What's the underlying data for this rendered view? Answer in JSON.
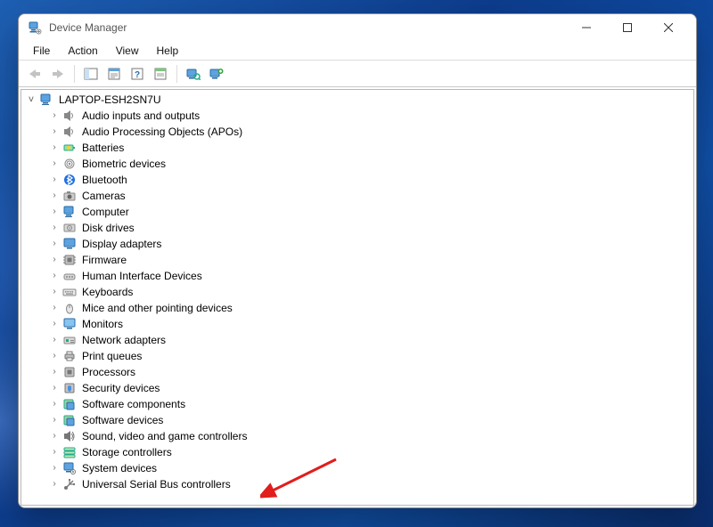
{
  "window": {
    "title": "Device Manager"
  },
  "menubar": {
    "file": "File",
    "action": "Action",
    "view": "View",
    "help": "Help"
  },
  "toolbar": {
    "back_tip": "Back",
    "forward_tip": "Forward",
    "show_hide_tip": "Show/Hide Console Tree",
    "properties_tip": "Properties",
    "help_tip": "Help",
    "scan_tip": "Scan for hardware changes",
    "add_driver_tip": "Add drivers"
  },
  "tree": {
    "root": {
      "label": "LAPTOP-ESH2SN7U",
      "icon": "computer",
      "expanded": true
    },
    "categories": [
      {
        "label": "Audio inputs and outputs",
        "icon": "audio"
      },
      {
        "label": "Audio Processing Objects (APOs)",
        "icon": "audio"
      },
      {
        "label": "Batteries",
        "icon": "battery"
      },
      {
        "label": "Biometric devices",
        "icon": "biometric"
      },
      {
        "label": "Bluetooth",
        "icon": "bluetooth"
      },
      {
        "label": "Cameras",
        "icon": "camera"
      },
      {
        "label": "Computer",
        "icon": "computer"
      },
      {
        "label": "Disk drives",
        "icon": "disk"
      },
      {
        "label": "Display adapters",
        "icon": "display"
      },
      {
        "label": "Firmware",
        "icon": "firmware"
      },
      {
        "label": "Human Interface Devices",
        "icon": "hid"
      },
      {
        "label": "Keyboards",
        "icon": "keyboard"
      },
      {
        "label": "Mice and other pointing devices",
        "icon": "mouse"
      },
      {
        "label": "Monitors",
        "icon": "monitor"
      },
      {
        "label": "Network adapters",
        "icon": "network"
      },
      {
        "label": "Print queues",
        "icon": "printer"
      },
      {
        "label": "Processors",
        "icon": "processor"
      },
      {
        "label": "Security devices",
        "icon": "security"
      },
      {
        "label": "Software components",
        "icon": "software"
      },
      {
        "label": "Software devices",
        "icon": "software"
      },
      {
        "label": "Sound, video and game controllers",
        "icon": "sound"
      },
      {
        "label": "Storage controllers",
        "icon": "storage"
      },
      {
        "label": "System devices",
        "icon": "system"
      },
      {
        "label": "Universal Serial Bus controllers",
        "icon": "usb"
      }
    ]
  },
  "annotation": {
    "type": "arrow",
    "color": "#e11d1d",
    "target_category_index": 20
  }
}
